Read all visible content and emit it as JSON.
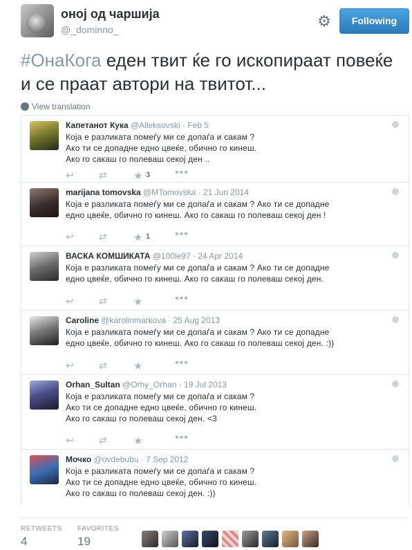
{
  "tweet": {
    "author_name": "оној од чаршија",
    "author_handle": "@_dominno_",
    "follow_button": "Following",
    "hashtag": "#ОнаКога",
    "text": " еден твит ќе го ископираат повеќе и се праат автори на твитот...",
    "view_translation": "View translation",
    "icons": {
      "settings": "gear-icon",
      "translation": "globe-icon"
    }
  },
  "replies": [
    {
      "name": "Капетанот Кука",
      "handle": "@Alleksovski",
      "date": "· Feb 5",
      "text": "Која е разликата помеѓу ми се допаѓа и сакам ?\nАко ти се допадне едно цвеќе, обично го кинеш.\nАко го сакаш го полеваш секој ден ..",
      "favorites": "3"
    },
    {
      "name": "marijana tomovska",
      "handle": "@MTomovska",
      "date": "· 21 Jun 2014",
      "text": "Која е разликата помеѓу ми се допаѓа и сакам ? Ако ти се допадне\nедно цвеќе, обично го кинеш. Ако го сакаш го полеваш секој ден !",
      "favorites": "1"
    },
    {
      "name": "ВАСКА КОМШИКАТА",
      "handle": "@100le97",
      "date": "· 24 Apr 2014",
      "text": "Која е разликата помеѓу ми се допаѓа и сакам ?  Ако ти се допадне\nедно цвеќе, обично го кинеш. Ако го сакаш го полеваш секој ден.",
      "favorites": ""
    },
    {
      "name": "Caroline",
      "handle": "@karolinmarkova",
      "date": "· 25 Aug 2013",
      "text": "Која е разликата помеѓу ми се допаѓа и сакам ? Ако ти се допадне\nедно цвеќе, обично го кинеш. Ако го сакаш го полеваш секој ден. :))",
      "favorites": ""
    },
    {
      "name": "Orhan_Sultan",
      "handle": "@Orhy_Orhan",
      "date": "· 19 Jul 2013",
      "text": "Која е разликата помеѓу ми се допаѓа и сакам ?\nАко ти се допадне едно цвеќе, обично го кинеш.\nАко го сакаш го полеваш секој ден. <3",
      "favorites": ""
    },
    {
      "name": "Мочко",
      "handle": "@ovdebubu",
      "date": "· 7 Sep 2012",
      "text": "Која е разликата помеѓу ми се допаѓа и сакам ?\nАко ти се допадне едно цвеќе, обично го кинеш.\nАко го сакаш го полеваш секој ден. :))",
      "favorites": ""
    }
  ],
  "action_icons": {
    "reply": "reply-icon",
    "retweet": "retweet-icon",
    "favorite": "star-icon",
    "more": "more-icon"
  },
  "stats": {
    "retweets_label": "RETWEETS",
    "retweets_value": "4",
    "favorites_label": "FAVORITES",
    "favorites_value": "19"
  },
  "colors": {
    "accent": "#2b7bb9",
    "hashtag": "#8899a6",
    "muted": "#8899a6",
    "action": "#aab8c2"
  }
}
